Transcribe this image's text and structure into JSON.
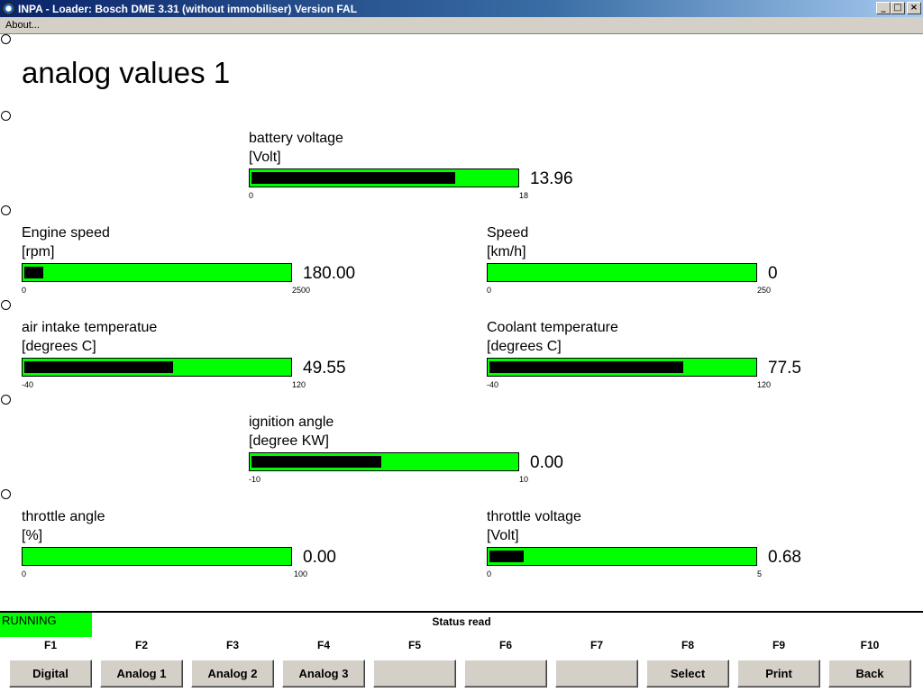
{
  "window": {
    "title": "INPA - Loader:  Bosch DME 3.31 (without immobiliser) Version FAL",
    "minimize_label": "_",
    "maximize_label": "□",
    "close_label": "×"
  },
  "menu": {
    "about_label": "About..."
  },
  "page_title": "analog values 1",
  "gauges": {
    "battery": {
      "label": "battery voltage",
      "unit": "[Volt]",
      "value": "13.96",
      "min": "0",
      "max": "18",
      "fraction": 0.77
    },
    "engine": {
      "label": "Engine speed",
      "unit": "[rpm]",
      "value": "180.00",
      "min": "0",
      "max": "2500",
      "fraction": 0.07
    },
    "speed": {
      "label": "Speed",
      "unit": "[km/h]",
      "value": "0",
      "min": "0",
      "max": "250",
      "fraction": 0.0
    },
    "air": {
      "label": "air intake temperatue",
      "unit": "[degrees C]",
      "value": "49.55",
      "min": "-40",
      "max": "120",
      "fraction": 0.56
    },
    "coolant": {
      "label": "Coolant temperature",
      "unit": "[degrees C]",
      "value": "77.5",
      "min": "-40",
      "max": "120",
      "fraction": 0.73
    },
    "ignition": {
      "label": "ignition angle",
      "unit": "[degree KW]",
      "value": "0.00",
      "min": "-10",
      "max": "10",
      "fraction": 0.49
    },
    "throttle_angle": {
      "label": "throttle angle",
      "unit": "[%]",
      "value": "0.00",
      "min": "0",
      "max": "100",
      "fraction": 0.0
    },
    "throttle_voltage": {
      "label": "throttle voltage",
      "unit": "[Volt]",
      "value": "0.68",
      "min": "0",
      "max": "5",
      "fraction": 0.13
    }
  },
  "status": {
    "state": "RUNNING",
    "message": "Status read"
  },
  "function_keys": [
    {
      "key": "F1",
      "label": "Digital"
    },
    {
      "key": "F2",
      "label": "Analog 1"
    },
    {
      "key": "F3",
      "label": "Analog 2"
    },
    {
      "key": "F4",
      "label": "Analog 3"
    },
    {
      "key": "F5",
      "label": ""
    },
    {
      "key": "F6",
      "label": ""
    },
    {
      "key": "F7",
      "label": ""
    },
    {
      "key": "F8",
      "label": "Select"
    },
    {
      "key": "F9",
      "label": "Print"
    },
    {
      "key": "F10",
      "label": "Back"
    }
  ],
  "colors": {
    "bar_bg": "#00ff00",
    "bar_fill": "#000000",
    "status_running": "#00ff00"
  }
}
